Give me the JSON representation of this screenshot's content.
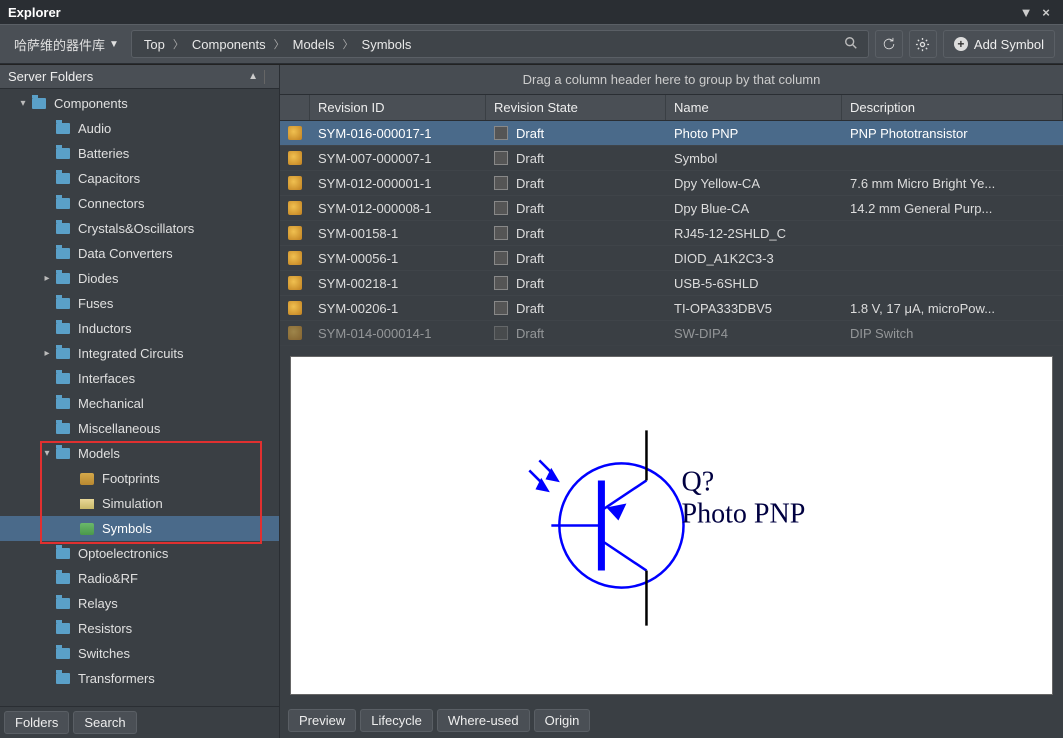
{
  "window": {
    "title": "Explorer"
  },
  "toolbar": {
    "vault_label": "哈萨维的器件库",
    "breadcrumb": [
      "Top",
      "Components",
      "Models",
      "Symbols"
    ],
    "add_label": "Add Symbol"
  },
  "sidebar": {
    "header": "Server Folders",
    "tabs": {
      "folders": "Folders",
      "search": "Search"
    },
    "tree": [
      {
        "label": "Components",
        "indent": 1,
        "expander": "▾",
        "icon": "folder"
      },
      {
        "label": "Audio",
        "indent": 2,
        "expander": "",
        "icon": "folder"
      },
      {
        "label": "Batteries",
        "indent": 2,
        "expander": "",
        "icon": "folder"
      },
      {
        "label": "Capacitors",
        "indent": 2,
        "expander": "",
        "icon": "folder"
      },
      {
        "label": "Connectors",
        "indent": 2,
        "expander": "",
        "icon": "folder"
      },
      {
        "label": "Crystals&Oscillators",
        "indent": 2,
        "expander": "",
        "icon": "folder"
      },
      {
        "label": "Data Converters",
        "indent": 2,
        "expander": "",
        "icon": "folder"
      },
      {
        "label": "Diodes",
        "indent": 2,
        "expander": "▸",
        "icon": "folder"
      },
      {
        "label": "Fuses",
        "indent": 2,
        "expander": "",
        "icon": "folder"
      },
      {
        "label": "Inductors",
        "indent": 2,
        "expander": "",
        "icon": "folder"
      },
      {
        "label": "Integrated Circuits",
        "indent": 2,
        "expander": "▸",
        "icon": "folder"
      },
      {
        "label": "Interfaces",
        "indent": 2,
        "expander": "",
        "icon": "folder"
      },
      {
        "label": "Mechanical",
        "indent": 2,
        "expander": "",
        "icon": "folder"
      },
      {
        "label": "Miscellaneous",
        "indent": 2,
        "expander": "",
        "icon": "folder"
      },
      {
        "label": "Models",
        "indent": 2,
        "expander": "▾",
        "icon": "folder"
      },
      {
        "label": "Footprints",
        "indent": 3,
        "expander": "",
        "icon": "footprint"
      },
      {
        "label": "Simulation",
        "indent": 3,
        "expander": "",
        "icon": "sim"
      },
      {
        "label": "Symbols",
        "indent": 3,
        "expander": "",
        "icon": "sym",
        "selected": true
      },
      {
        "label": "Optoelectronics",
        "indent": 2,
        "expander": "",
        "icon": "folder"
      },
      {
        "label": "Radio&RF",
        "indent": 2,
        "expander": "",
        "icon": "folder"
      },
      {
        "label": "Relays",
        "indent": 2,
        "expander": "",
        "icon": "folder"
      },
      {
        "label": "Resistors",
        "indent": 2,
        "expander": "",
        "icon": "folder"
      },
      {
        "label": "Switches",
        "indent": 2,
        "expander": "",
        "icon": "folder"
      },
      {
        "label": "Transformers",
        "indent": 2,
        "expander": "",
        "icon": "folder"
      }
    ]
  },
  "grid": {
    "group_hint": "Drag a column header here to group by that column",
    "columns": {
      "rev": "Revision ID",
      "state": "Revision State",
      "name": "Name",
      "desc": "Description"
    },
    "rows": [
      {
        "rev": "SYM-016-000017-1",
        "state": "Draft",
        "name": "Photo PNP",
        "desc": "PNP Phototransistor",
        "selected": true
      },
      {
        "rev": "SYM-007-000007-1",
        "state": "Draft",
        "name": "Symbol",
        "desc": ""
      },
      {
        "rev": "SYM-012-000001-1",
        "state": "Draft",
        "name": "Dpy Yellow-CA",
        "desc": "7.6 mm Micro Bright Ye..."
      },
      {
        "rev": "SYM-012-000008-1",
        "state": "Draft",
        "name": "Dpy Blue-CA",
        "desc": "14.2 mm General Purp..."
      },
      {
        "rev": "SYM-00158-1",
        "state": "Draft",
        "name": "RJ45-12-2SHLD_C",
        "desc": ""
      },
      {
        "rev": "SYM-00056-1",
        "state": "Draft",
        "name": "DIOD_A1K2C3-3",
        "desc": ""
      },
      {
        "rev": "SYM-00218-1",
        "state": "Draft",
        "name": "USB-5-6SHLD",
        "desc": ""
      },
      {
        "rev": "SYM-00206-1",
        "state": "Draft",
        "name": "TI-OPA333DBV5",
        "desc": "1.8 V, 17 μA, microPow..."
      },
      {
        "rev": "SYM-014-000014-1",
        "state": "Draft",
        "name": "SW-DIP4",
        "desc": "DIP Switch",
        "cut": true
      }
    ]
  },
  "preview": {
    "designator": "Q?",
    "comment": "Photo PNP",
    "tabs": [
      "Preview",
      "Lifecycle",
      "Where-used",
      "Origin"
    ]
  }
}
